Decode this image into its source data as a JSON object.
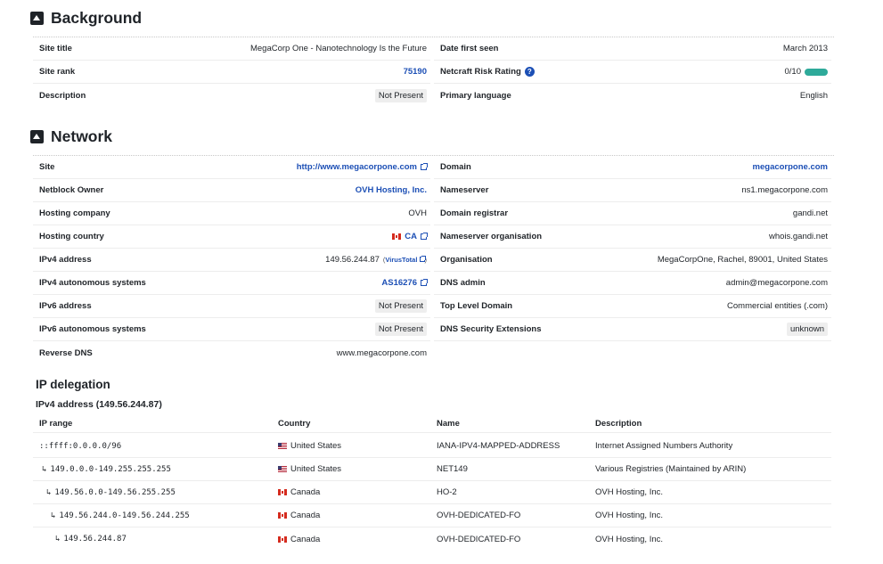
{
  "background": {
    "title": "Background",
    "site_title_label": "Site title",
    "site_title_value": "MegaCorp One - Nanotechnology Is the Future",
    "site_rank_label": "Site rank",
    "site_rank_value": "75190",
    "description_label": "Description",
    "description_value": "Not Present",
    "date_first_seen_label": "Date first seen",
    "date_first_seen_value": "March 2013",
    "risk_label": "Netcraft Risk Rating",
    "risk_help": "?",
    "risk_value": "0/10",
    "risk_fraction": 0,
    "primary_language_label": "Primary language",
    "primary_language_value": "English"
  },
  "network": {
    "title": "Network",
    "left": [
      {
        "label": "Site",
        "value": "http://www.megacorpone.com"
      },
      {
        "label": "Netblock Owner",
        "value": "OVH Hosting, Inc."
      },
      {
        "label": "Hosting company",
        "value": "OVH"
      },
      {
        "label": "Hosting country",
        "value": "CA"
      },
      {
        "label": "IPv4 address",
        "value": "149.56.244.87",
        "extra_open": "(",
        "extra_link": "VirusTotal",
        "extra_close": ")"
      },
      {
        "label": "IPv4 autonomous systems",
        "value": "AS16276"
      },
      {
        "label": "IPv6 address",
        "value": "Not Present"
      },
      {
        "label": "IPv6 autonomous systems",
        "value": "Not Present"
      },
      {
        "label": "Reverse DNS",
        "value": "www.megacorpone.com"
      }
    ],
    "right": [
      {
        "label": "Domain",
        "value": "megacorpone.com"
      },
      {
        "label": "Nameserver",
        "value": "ns1.megacorpone.com"
      },
      {
        "label": "Domain registrar",
        "value": "gandi.net"
      },
      {
        "label": "Nameserver organisation",
        "value": "whois.gandi.net"
      },
      {
        "label": "Organisation",
        "value": "MegaCorpOne, Rachel, 89001, United States"
      },
      {
        "label": "DNS admin",
        "value": "admin@megacorpone.com"
      },
      {
        "label": "Top Level Domain",
        "value": "Commercial entities (.com)"
      },
      {
        "label": "DNS Security Extensions",
        "value": "unknown"
      }
    ]
  },
  "ip_delegation": {
    "title": "IP delegation",
    "subtitle": "IPv4 address (149.56.244.87)",
    "headers": [
      "IP range",
      "Country",
      "Name",
      "Description"
    ],
    "arrow": "↳",
    "rows": [
      {
        "range": "::ffff:0.0.0.0/96",
        "flag": "us",
        "country": "United States",
        "name": "IANA-IPV4-MAPPED-ADDRESS",
        "description": "Internet Assigned Numbers Authority"
      },
      {
        "range": "149.0.0.0-149.255.255.255",
        "flag": "us",
        "country": "United States",
        "name": "NET149",
        "description": "Various Registries (Maintained by ARIN)"
      },
      {
        "range": "149.56.0.0-149.56.255.255",
        "flag": "ca",
        "country": "Canada",
        "name": "HO-2",
        "description": "OVH Hosting, Inc."
      },
      {
        "range": "149.56.244.0-149.56.244.255",
        "flag": "ca",
        "country": "Canada",
        "name": "OVH-DEDICATED-FO",
        "description": "OVH Hosting, Inc."
      },
      {
        "range": "149.56.244.87",
        "flag": "ca",
        "country": "Canada",
        "name": "OVH-DEDICATED-FO",
        "description": "OVH Hosting, Inc."
      }
    ]
  }
}
